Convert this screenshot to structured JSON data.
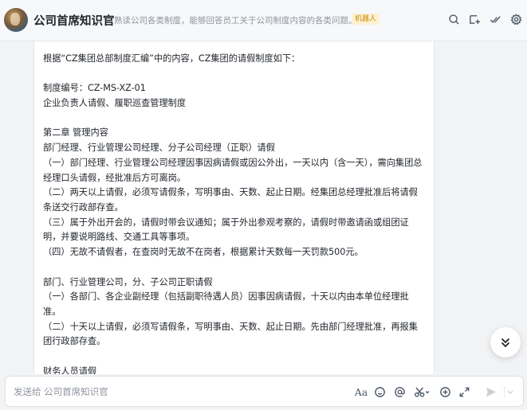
{
  "header": {
    "title": "公司首席知识官",
    "subtitle": "熟读公司各类制度，能够回答员工关于公司制度内容的各类问题。",
    "badge": "机器人",
    "icons": [
      "search-icon",
      "add-chat-icon",
      "check-icon",
      "settings-icon"
    ]
  },
  "message": {
    "paragraphs": [
      "根据“CZ集团总部制度汇编”中的内容，CZ集团的请假制度如下：",
      "",
      "制度编号：CZ-MS-XZ-01",
      "企业负责人请假、履职巡查管理制度",
      "",
      "第二章 管理内容",
      "部门经理、行业管理公司经理、分子公司经理（正职）请假",
      "（一）部门经理、行业管理公司经理因事因病请假或因公外出，一天以内（含一天），需向集团总经理口头请假，经批准后方可离岗。",
      "（二）两天以上请假，必须写请假条，写明事由、天数、起止日期。经集团总经理批准后将请假条送交行政部存查。",
      "（三）属于外出开会的，请假时带会议通知；属于外出参观考察的，请假时带邀请函或组团证明，并要说明路线、交通工具等事项。",
      "（四）无故不请假者，在查岗时无故不在岗者，根据累计天数每一天罚款500元。",
      "",
      "部门、行业管理公司，分、子公司正职请假",
      "（一）各部门、各企业副经理（包括副职待遇人员）因事因病请假，十天以内由本单位经理批准。",
      "（二）十天以上请假，必须写请假条，写明事由、天数、起止日期。先由部门经理批准，再报集团行政部存查。",
      "",
      "财务人员请假"
    ]
  },
  "input": {
    "placeholder": "发送给 公司首席知识官",
    "format_label": "Aa",
    "icons": [
      "format-icon",
      "emoji-icon",
      "mention-icon",
      "scissors-icon",
      "add-icon",
      "expand-icon",
      "send-icon",
      "send-options-icon"
    ]
  },
  "colors": {
    "badge_bg": "#fdf1d2",
    "badge_text": "#c68a06",
    "header_bg": "#f7f8fa",
    "page_bg": "#f2f3f5"
  }
}
